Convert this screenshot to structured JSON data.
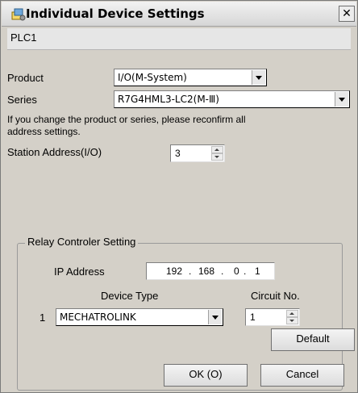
{
  "window": {
    "title": "Individual Device Settings",
    "close_glyph": "✕"
  },
  "plc": {
    "name": "PLC1"
  },
  "product": {
    "label": "Product",
    "value": "I/O(M-System)"
  },
  "series": {
    "label": "Series",
    "value": "R7G4HML3-LC2(M-Ⅲ)"
  },
  "notice": {
    "line1": "If you change the product or series, please reconfirm all",
    "line2": "address settings."
  },
  "station": {
    "label": "Station Address(I/O)",
    "value": "3"
  },
  "relay": {
    "legend": "Relay Controler Setting",
    "ip_label": "IP Address",
    "ip": [
      "192",
      "168",
      "0",
      "1"
    ],
    "device_type_header": "Device Type",
    "circuit_header": "Circuit No.",
    "rows": [
      {
        "index": "1",
        "device_type": "MECHATROLINK",
        "circuit": "1"
      }
    ]
  },
  "buttons": {
    "default": "Default",
    "ok": "OK (O)",
    "cancel": "Cancel"
  },
  "colors": {
    "dialog_bg": "#d4d0c8",
    "title_bar": "#e0e0e0"
  },
  "icons": {
    "title": "device-settings-icon",
    "close": "close-icon",
    "dropdown": "chevron-down-icon",
    "spin": "spin-arrows-icon"
  }
}
